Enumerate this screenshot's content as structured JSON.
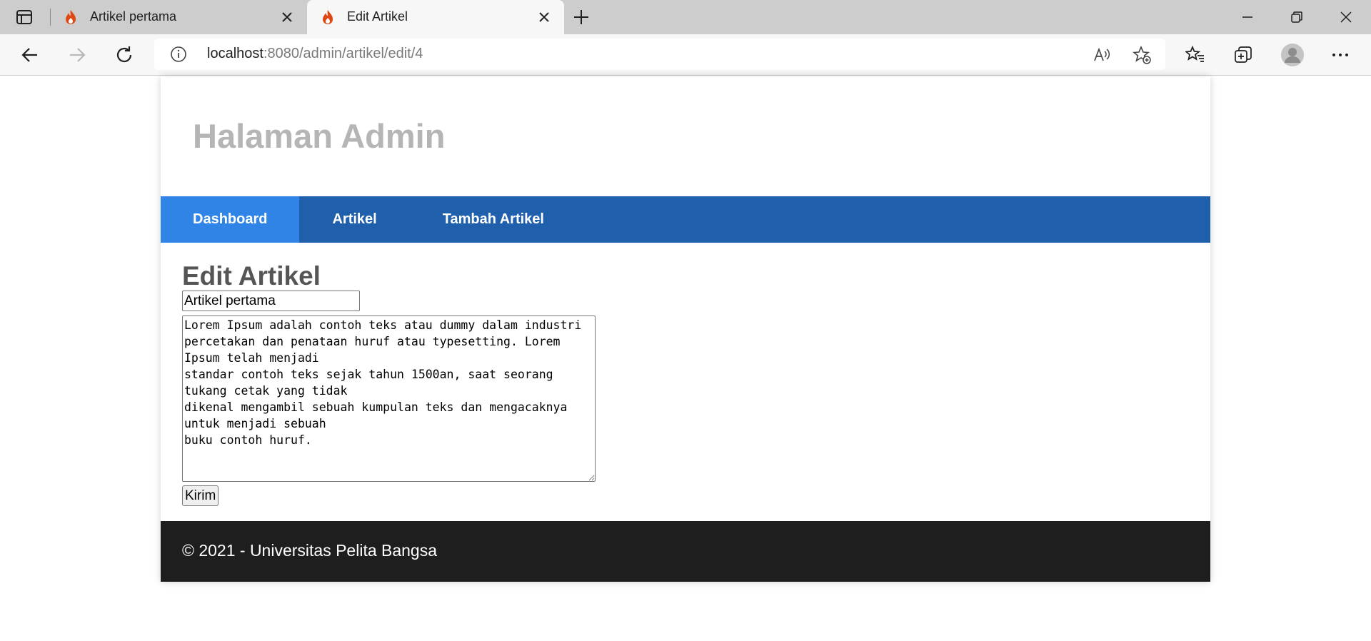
{
  "browser": {
    "tabs": [
      {
        "title": "Artikel pertama",
        "active": false
      },
      {
        "title": "Edit Artikel",
        "active": true
      }
    ],
    "url_host": "localhost",
    "url_rest": ":8080/admin/artikel/edit/4",
    "icons": {
      "sidebar": "sidebar-toggle-icon",
      "favicon": "flame-icon",
      "close": "close-icon",
      "new_tab": "plus-icon",
      "back": "back-arrow-icon",
      "forward": "forward-arrow-icon",
      "refresh": "refresh-icon",
      "info": "info-icon",
      "read_aloud": "read-aloud-icon",
      "add_favorite": "star-plus-icon",
      "favorites": "favorites-icon",
      "collections": "collections-icon",
      "profile": "avatar-icon",
      "menu": "more-icon"
    }
  },
  "site": {
    "title": "Halaman Admin"
  },
  "nav": {
    "items": [
      {
        "label": "Dashboard",
        "active": true
      },
      {
        "label": "Artikel",
        "active": false
      },
      {
        "label": "Tambah Artikel",
        "active": false
      }
    ]
  },
  "main": {
    "heading": "Edit Artikel",
    "title_value": "Artikel pertama",
    "body_value": "Lorem Ipsum adalah contoh teks atau dummy dalam industri\npercetakan dan penataan huruf atau typesetting. Lorem Ipsum telah menjadi\nstandar contoh teks sejak tahun 1500an, saat seorang tukang cetak yang tidak\ndikenal mengambil sebuah kumpulan teks dan mengacaknya untuk menjadi sebuah\nbuku contoh huruf.",
    "submit_label": "Kirim"
  },
  "footer": {
    "text": "© 2021 - Universitas Pelita Bangsa"
  },
  "colors": {
    "nav_bg": "#1f5fac",
    "nav_active": "#2f84e5",
    "footer_bg": "#1e1e1e",
    "site_title": "#b5b5b5"
  }
}
